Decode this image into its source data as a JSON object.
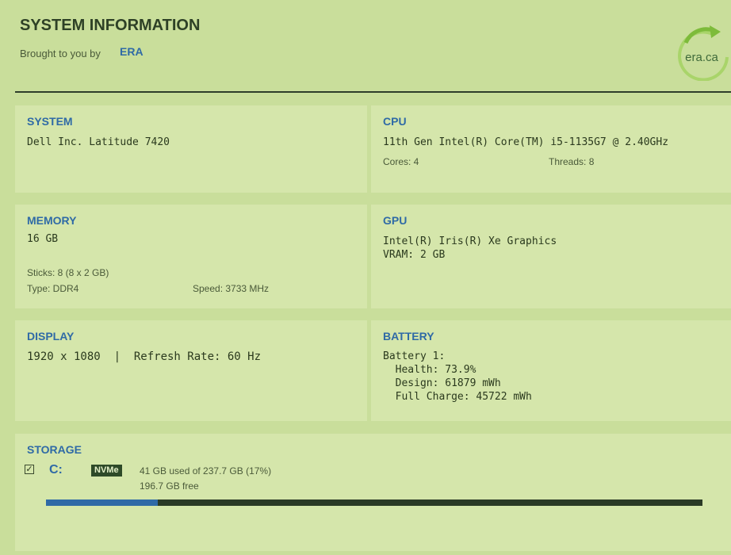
{
  "header": {
    "title": "SYSTEM INFORMATION",
    "subtitle": "Brought to you by",
    "link": "ERA",
    "logo_text": "era.ca"
  },
  "system": {
    "title": "SYSTEM",
    "value": "Dell Inc. Latitude 7420"
  },
  "cpu": {
    "title": "CPU",
    "value": "11th Gen Intel(R) Core(TM) i5-1135G7 @ 2.40GHz",
    "cores": "Cores: 4",
    "threads": "Threads: 8"
  },
  "memory": {
    "title": "MEMORY",
    "value": "16 GB",
    "sticks": "Sticks: 8 (8 x 2 GB)",
    "type": "Type: DDR4",
    "speed": "Speed: 3733 MHz"
  },
  "gpu": {
    "title": "GPU",
    "name": "Intel(R) Iris(R) Xe Graphics",
    "vram": "VRAM: 2 GB"
  },
  "display": {
    "title": "DISPLAY",
    "value": "1920 x 1080  |  Refresh Rate: 60 Hz"
  },
  "battery": {
    "title": "BATTERY",
    "name": "Battery 1:",
    "health": "  Health: 73.9%",
    "design": "  Design: 61879 mWh",
    "full_charge": "  Full Charge: 45722 mWh"
  },
  "storage": {
    "title": "STORAGE",
    "drive": "C:",
    "type_badge": "NVMe",
    "used": "41 GB used of 237.7 GB  (17%)",
    "free": "196.7 GB free",
    "used_fraction": 0.17,
    "checked": true
  },
  "colors": {
    "accent": "#2f6aa6",
    "background": "#c9de9b",
    "panel": "#d5e6ab",
    "bar_track": "#2a3a26",
    "logo_ring": "#7dbb3a"
  }
}
